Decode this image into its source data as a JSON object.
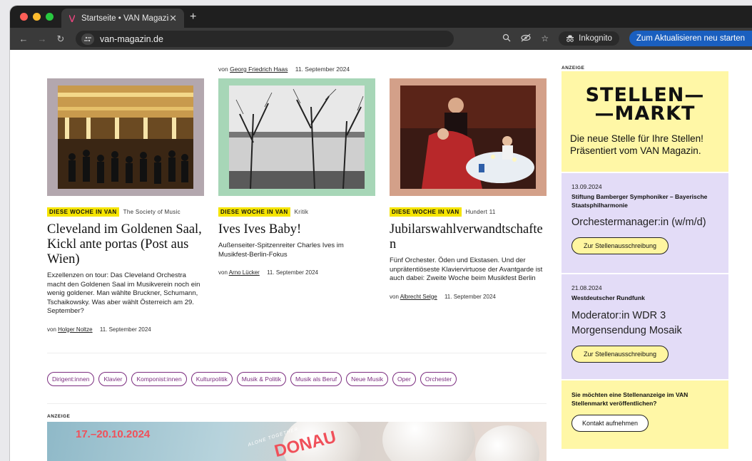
{
  "browser": {
    "tab_title": "Startseite • VAN Magazin",
    "url": "van-magazin.de",
    "incognito_label": "Inkognito",
    "update_label": "Zum Aktualisieren neu starten",
    "colors": {
      "frame": "#1f1f1f",
      "toolbar": "#3a3a3a",
      "update": "#1a5fbf"
    }
  },
  "top_byline": {
    "prefix": "von",
    "author": "Georg Friedrich Haas",
    "date": "11. September 2024"
  },
  "articles": [
    {
      "kicker": "DIESE WOCHE IN VAN",
      "category": "The Society of Music",
      "title": "Cleveland im Goldenen Saal, Kickl ante portas (Post aus Wien)",
      "teaser": "Exzellenzen on tour: Das Cleveland Orchestra macht den Goldenen Saal im Musikverein noch ein wenig goldener. Man wählte Bruckner, Schumann, Tschaikowsky. Was aber wählt Österreich am 29. September?",
      "byline_prefix": "von",
      "author": "Holger Noltze",
      "date": "11. September 2024",
      "image_bg": "#b3a7ae"
    },
    {
      "kicker": "DIESE WOCHE IN VAN",
      "category": "Kritik",
      "title": "Ives Ives Baby!",
      "teaser": "Außenseiter-Spitzenreiter Charles Ives im Musikfest-Berlin-Fokus",
      "byline_prefix": "von",
      "author": "Arno Lücker",
      "date": "11. September 2024",
      "image_bg": "#a7d6b7"
    },
    {
      "kicker": "DIESE WOCHE IN VAN",
      "category": "Hundert 11",
      "title": "Jubilarswahlverwandtschafte n",
      "teaser": "Fünf Orchester. Öden und Ekstasen. Und der unprätentiöseste Klaviervirtuose der Avantgarde ist auch dabei: Zweite Woche beim Musikfest Berlin",
      "byline_prefix": "von",
      "author": "Albrecht Selge",
      "date": "11. September 2024",
      "image_bg": "#d3a089"
    }
  ],
  "tags": [
    "Dirigent:innen",
    "Klavier",
    "Komponist:innen",
    "Kulturpolitik",
    "Musik & Politik",
    "Musik als Beruf",
    "Neue Musik",
    "Oper",
    "Orchester"
  ],
  "ad_label": "ANZEIGE",
  "banner": {
    "date": "17.–20.10.2024",
    "overline": "ALONE TOGETHER",
    "word": "DONAU"
  },
  "sidebar": {
    "ad_label": "ANZEIGE",
    "logo_line1": "STELLEN—",
    "logo_line2": "—MARKT",
    "tagline": "Die neue Stelle für Ihre Stellen! Präsentiert vom VAN Magazin.",
    "jobs": [
      {
        "date": "13.09.2024",
        "org": "Stiftung Bamberger Symphoniker – Bayerische Staatsphilharmonie",
        "role": "Orchestermanager:in (w/m/d)",
        "button": "Zur Stellenausschreibung"
      },
      {
        "date": "21.08.2024",
        "org": "Westdeutscher Rundfunk",
        "role": "Moderator:in WDR 3 Morgensendung Mosaik",
        "button": "Zur Stellenausschreibung"
      }
    ],
    "cta_question": "Sie möchten eine Stellenanzeige im VAN Stellenmarkt veröffentlichen?",
    "cta_button": "Kontakt aufnehmen",
    "colors": {
      "yellow": "#fff7a6",
      "lavender": "#e3dcf7",
      "tag": "#7b2c7f",
      "highlight": "#f5e400"
    }
  }
}
